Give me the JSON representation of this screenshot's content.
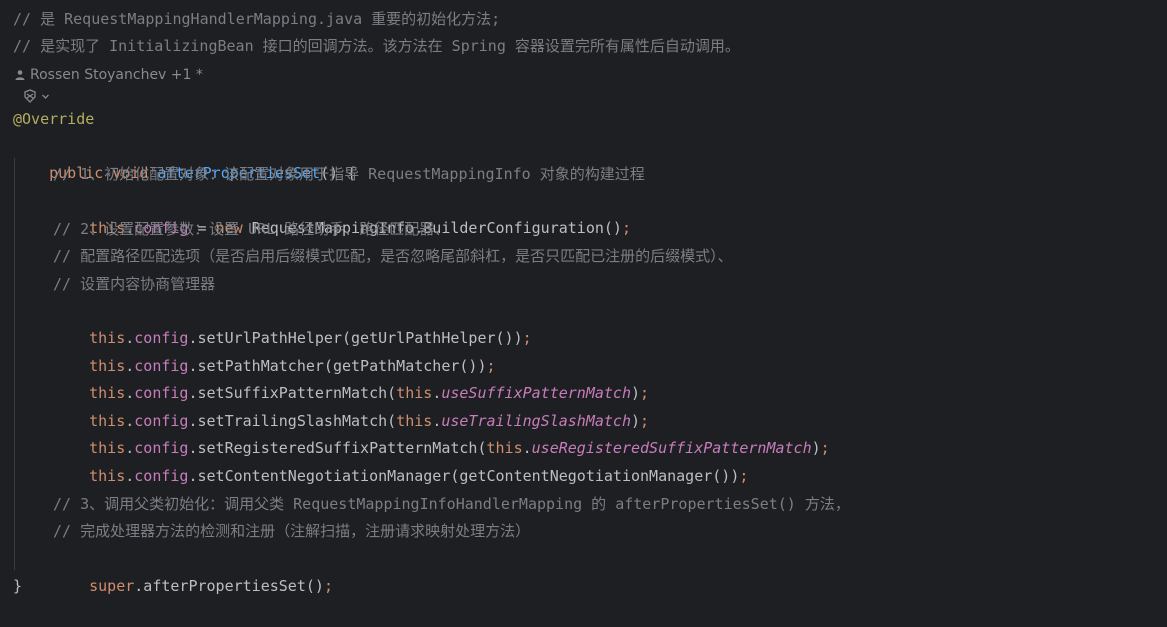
{
  "comment_line1": "// 是 RequestMappingHandlerMapping.java 重要的初始化方法;",
  "comment_line2": "// 是实现了 InitializingBean 接口的回调方法。该方法在 Spring 容器设置完所有属性后自动调用。",
  "author_hint": "Rossen Stoyanchev +1 *",
  "annotation": "@Override",
  "sig": {
    "public": "public",
    "void": "void",
    "name": "afterPropertiesSet",
    "rest": "() {"
  },
  "c1": "// 1、初始化配置对象：该配置对象用于指导 RequestMappingInfo 对象的构建过程",
  "l_config": {
    "this": "this",
    "dot": ".",
    "config": "config",
    "eq": " = ",
    "new": "new",
    "rest": " RequestMappingInfo.BuilderConfiguration()",
    "semi": ";"
  },
  "c2a": "// 2、设置配置参数：设置 URL 路径助手、路径匹配器、",
  "c2b": "// 配置路径匹配选项（是否启用后缀模式匹配，是否忽略尾部斜杠，是否只匹配已注册的后缀模式）、",
  "c2c": "// 设置内容协商管理器",
  "set_lines": [
    {
      "call": ".setUrlPathHelper(getUrlPathHelper())",
      "arg": "",
      "close": ""
    },
    {
      "call": ".setPathMatcher(getPathMatcher())",
      "arg": "",
      "close": ""
    },
    {
      "call": ".setSuffixPatternMatch(",
      "arg": "useSuffixPatternMatch",
      "close": ")"
    },
    {
      "call": ".setTrailingSlashMatch(",
      "arg": "useTrailingSlashMatch",
      "close": ")"
    },
    {
      "call": ".setRegisteredSuffixPatternMatch(",
      "arg": "useRegisteredSuffixPatternMatch",
      "close": ")"
    },
    {
      "call": ".setContentNegotiationManager(getContentNegotiationManager())",
      "arg": "",
      "close": ""
    }
  ],
  "kw_this": "this",
  "kw_config": "config",
  "dot": ".",
  "semi": ";",
  "c3a": "// 3、调用父类初始化：调用父类 RequestMappingInfoHandlerMapping 的 afterPropertiesSet() 方法，",
  "c3b": "// 完成处理器方法的检测和注册（注解扫描，注册请求映射处理方法）",
  "super_line": {
    "super": "super",
    "rest": ".afterPropertiesSet()",
    "semi": ";"
  },
  "close_brace": "}",
  "colors": {
    "background": "#1e1f22",
    "comment": "#7a7e85",
    "keyword": "#cf8e6d",
    "field": "#c77dbb",
    "annotation": "#b3ae60",
    "method_decl": "#56a8f5",
    "text": "#bcbec4"
  }
}
